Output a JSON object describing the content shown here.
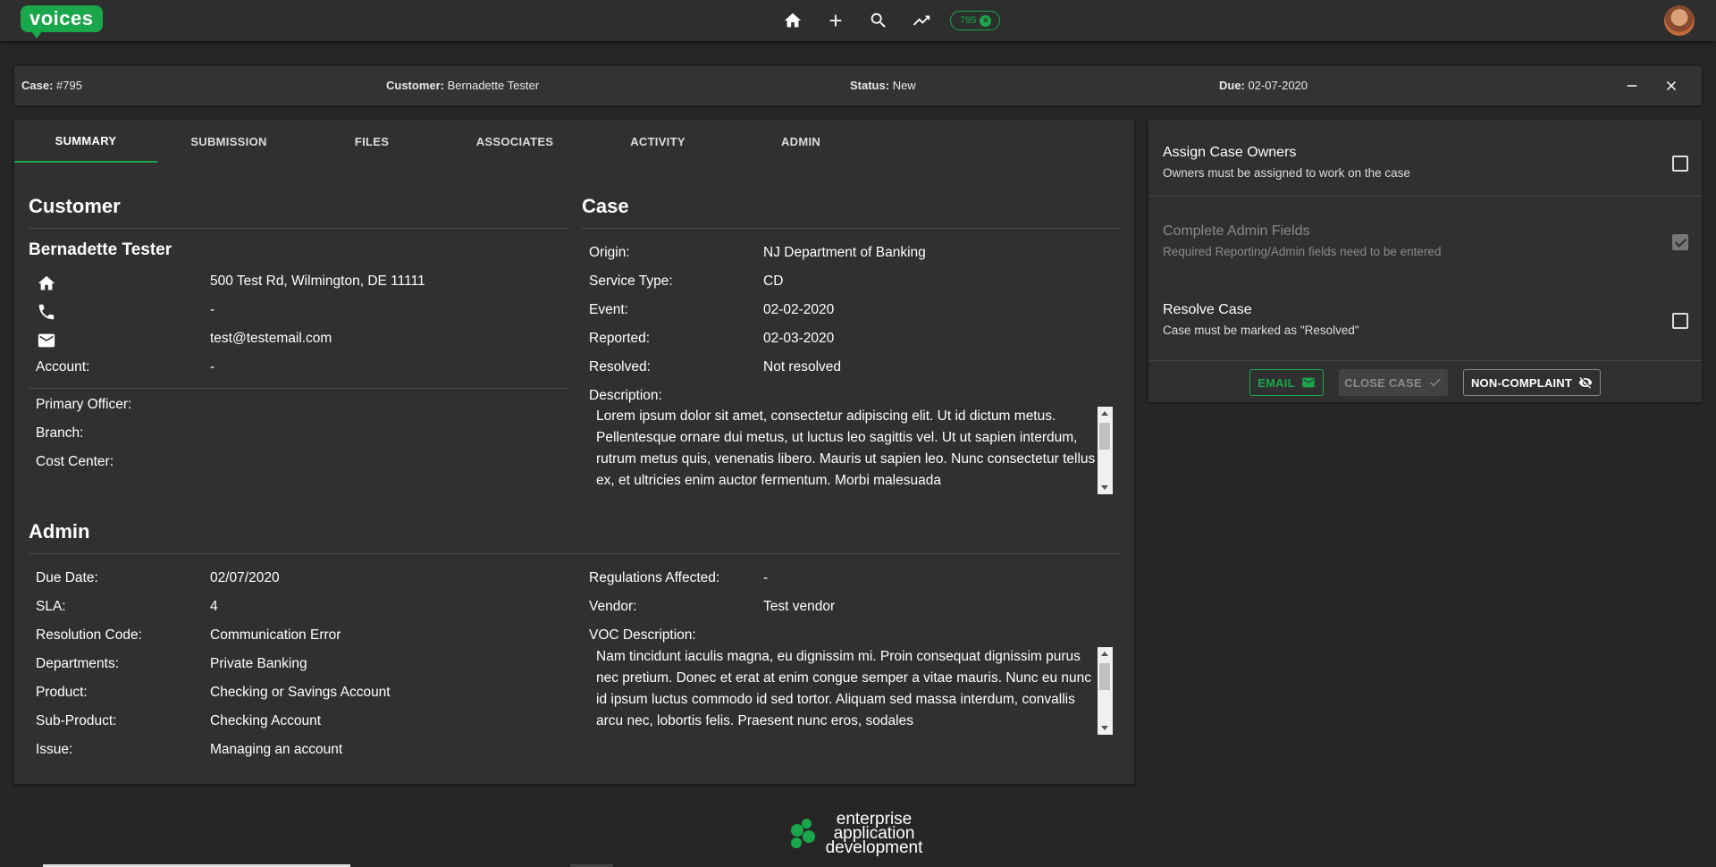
{
  "app": {
    "logo_text": "voices",
    "case_chip": "795"
  },
  "nav": [
    "home-icon",
    "add-icon",
    "search-icon",
    "trending-icon"
  ],
  "case_header": {
    "case_label": "Case:",
    "case_value": "#795",
    "customer_label": "Customer:",
    "customer_value": "Bernadette Tester",
    "status_label": "Status:",
    "status_value": "New",
    "due_label": "Due:",
    "due_value": "02-07-2020"
  },
  "tabs": [
    "SUMMARY",
    "SUBMISSION",
    "FILES",
    "ASSOCIATES",
    "ACTIVITY",
    "ADMIN"
  ],
  "customer": {
    "title": "Customer",
    "name": "Bernadette Tester",
    "address": "500 Test Rd, Wilmington, DE 11111",
    "phone": "-",
    "email": "test@testemail.com",
    "account_label": "Account:",
    "account_value": "-",
    "primary_officer_label": "Primary Officer:",
    "branch_label": "Branch:",
    "cost_center_label": "Cost Center:"
  },
  "case": {
    "title": "Case",
    "origin_label": "Origin:",
    "origin_value": "NJ Department of Banking",
    "service_type_label": "Service Type:",
    "service_type_value": "CD",
    "event_label": "Event:",
    "event_value": "02-02-2020",
    "reported_label": "Reported:",
    "reported_value": "02-03-2020",
    "resolved_label": "Resolved:",
    "resolved_value": "Not resolved",
    "description_label": "Description:",
    "description_text": "Lorem ipsum dolor sit amet, consectetur adipiscing elit. Ut id dictum metus. Pellentesque ornare dui metus, ut luctus leo sagittis vel. Ut ut sapien interdum, rutrum metus quis, venenatis libero. Mauris ut sapien leo. Nunc consectetur tellus ex, et ultricies enim auctor fermentum. Morbi malesuada"
  },
  "admin": {
    "title": "Admin",
    "due_date_label": "Due Date:",
    "due_date_value": "02/07/2020",
    "sla_label": "SLA:",
    "sla_value": "4",
    "resolution_code_label": "Resolution Code:",
    "resolution_code_value": "Communication Error",
    "departments_label": "Departments:",
    "departments_value": "Private Banking",
    "product_label": "Product:",
    "product_value": "Checking or Savings Account",
    "sub_product_label": "Sub-Product:",
    "sub_product_value": "Checking Account",
    "issue_label": "Issue:",
    "issue_value": "Managing an account",
    "regulations_label": "Regulations Affected:",
    "regulations_value": "-",
    "vendor_label": "Vendor:",
    "vendor_value": "Test vendor",
    "voc_label": "VOC Description:",
    "voc_text": "Nam tincidunt iaculis magna, eu dignissim mi. Proin consequat dignissim purus nec pretium. Donec et erat at enim congue semper a vitae mauris. Nunc eu nunc id ipsum luctus commodo id sed tortor. Aliquam sed massa interdum, convallis arcu nec, lobortis felis. Praesent nunc eros, sodales"
  },
  "tasks": [
    {
      "title": "Assign Case Owners",
      "subtitle": "Owners must be assigned to work on the case",
      "checked": false,
      "disabled": false
    },
    {
      "title": "Complete Admin Fields",
      "subtitle": "Required Reporting/Admin fields need to be entered",
      "checked": true,
      "disabled": true
    },
    {
      "title": "Resolve Case",
      "subtitle": "Case must be marked as \"Resolved\"",
      "checked": false,
      "disabled": false
    }
  ],
  "actions": {
    "email": "EMAIL",
    "close_case": "CLOSE CASE",
    "non_complaint": "NON-COMPLAINT"
  },
  "footer": {
    "line1": "enterprise",
    "line2": "application",
    "line3": "development"
  },
  "colors": {
    "accent": "#1aa64a",
    "background": "#262626",
    "card": "#303030"
  }
}
